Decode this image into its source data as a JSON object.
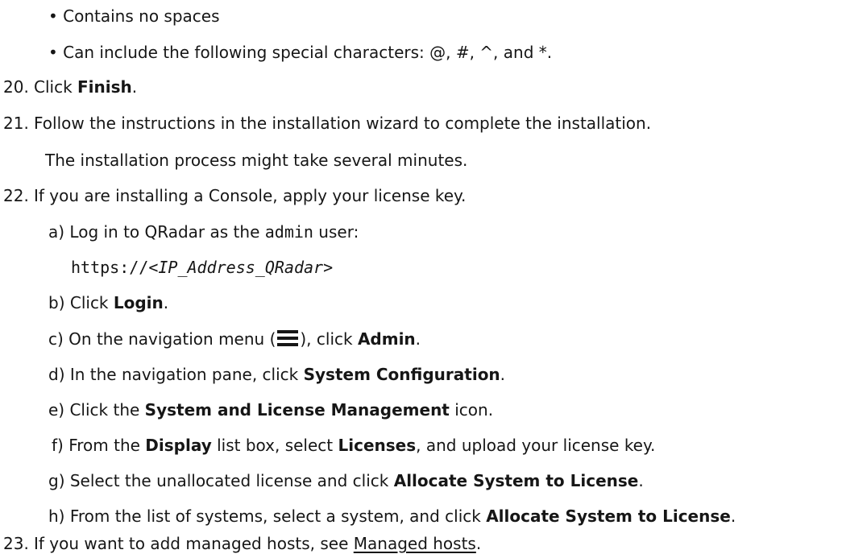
{
  "bullets": [
    "• Contains no spaces",
    "• Can include the following special characters: @, #, ^, and *."
  ],
  "steps": {
    "s20": {
      "num": "20.",
      "pre": "Click ",
      "bold": "Finish",
      "post": "."
    },
    "s21": {
      "num": "21.",
      "text": "Follow the instructions in the installation wizard to complete the installation.",
      "note": "The installation process might take several minutes."
    },
    "s22": {
      "num": "22.",
      "text": "If you are installing a Console, apply your license key."
    },
    "s23": {
      "num": "23.",
      "pre": "If you want to add managed hosts, see ",
      "link": "Managed hosts",
      "post": "."
    }
  },
  "substeps": {
    "a": {
      "letter": "a)",
      "pre": "Log in to QRadar as the ",
      "code": "admin",
      "post": " user:",
      "url_prefix": "https://",
      "url_var": "<IP_Address_QRadar>"
    },
    "b": {
      "letter": "b)",
      "pre": "Click ",
      "bold": "Login",
      "post": "."
    },
    "c": {
      "letter": "c)",
      "pre": "On the navigation menu (",
      "mid": "), click ",
      "bold": "Admin",
      "post": ".",
      "icon": "hamburger-menu-icon"
    },
    "d": {
      "letter": "d)",
      "pre": "In the navigation pane, click ",
      "bold": "System Configuration",
      "post": "."
    },
    "e": {
      "letter": "e)",
      "pre": "Click the ",
      "bold": "System and License Management",
      "post": " icon."
    },
    "f": {
      "letter": "f)",
      "pre": "From the ",
      "bold1": "Display",
      "mid": " list box, select ",
      "bold2": "Licenses",
      "post": ", and upload your license key."
    },
    "g": {
      "letter": "g)",
      "pre": "Select the unallocated license and click ",
      "bold": "Allocate System to License",
      "post": "."
    },
    "h": {
      "letter": "h)",
      "pre": "From the list of systems, select a system, and click ",
      "bold": "Allocate System to License",
      "post": "."
    }
  }
}
